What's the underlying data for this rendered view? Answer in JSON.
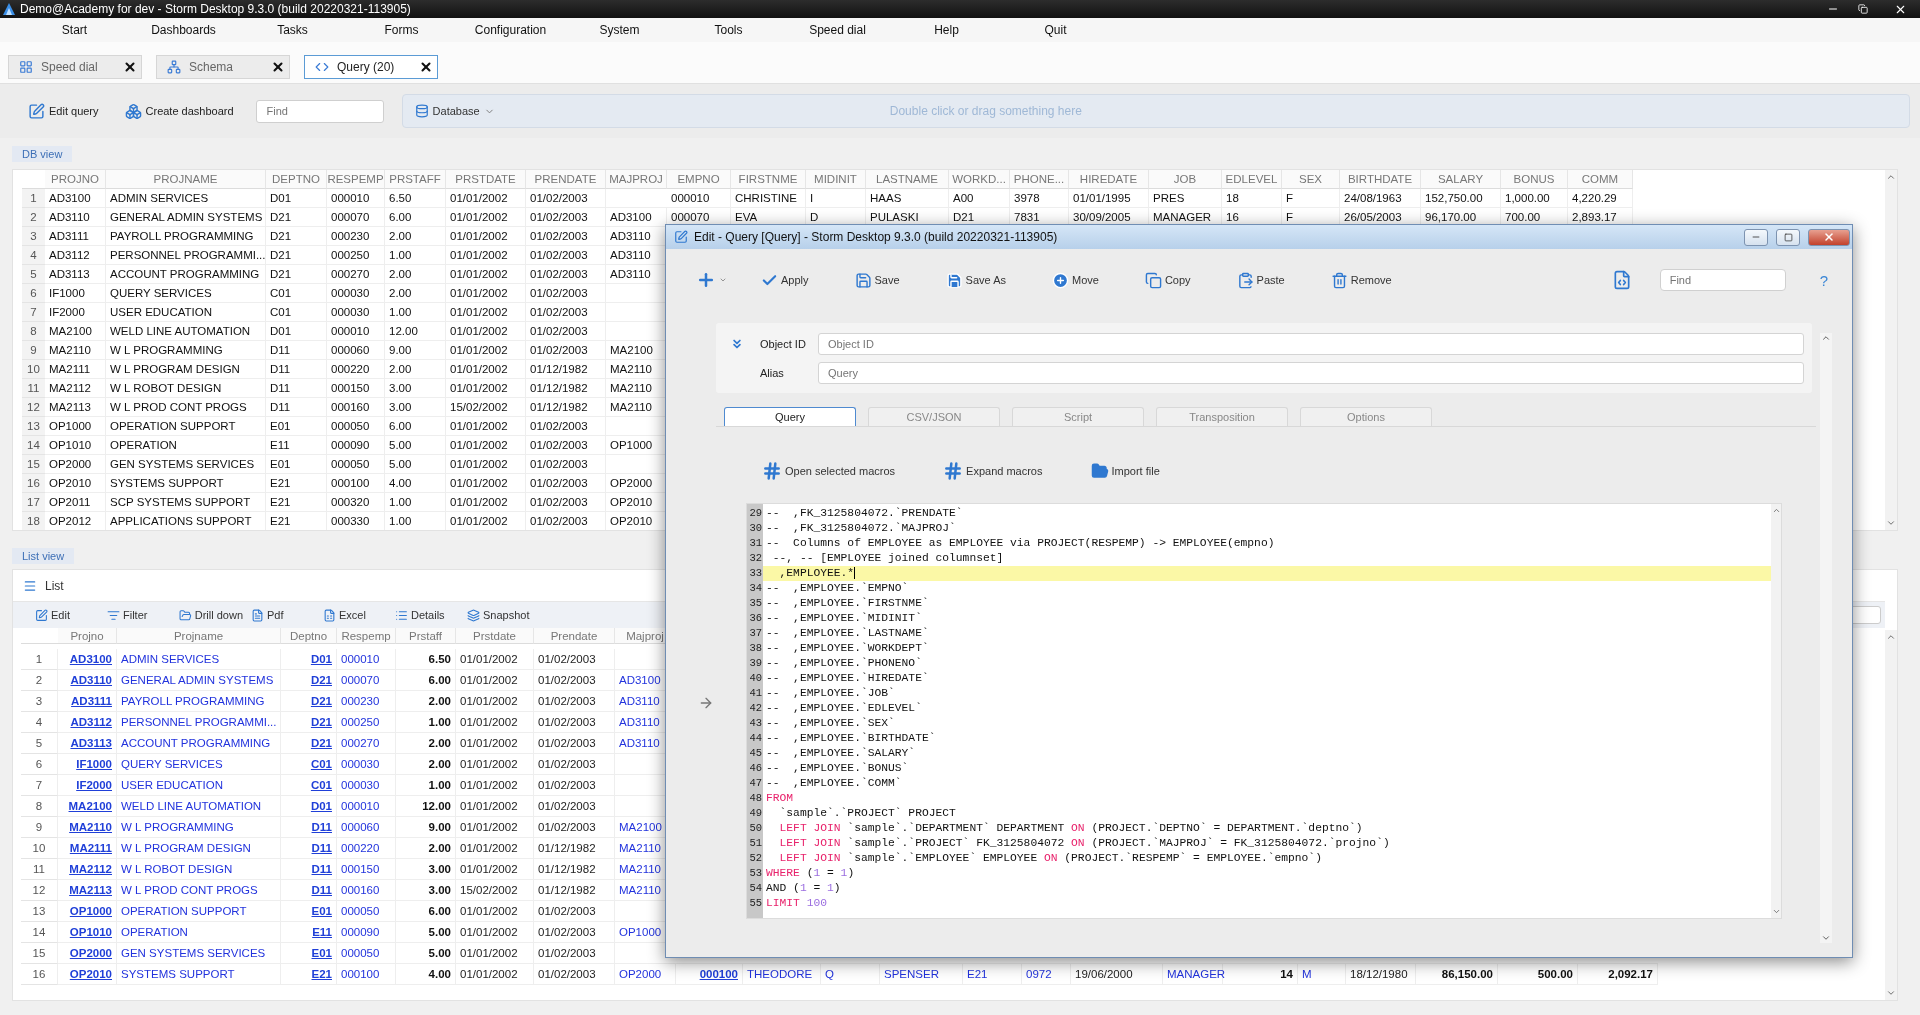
{
  "window": {
    "title": "Demo@Academy for dev -  Storm Desktop 9.3.0 (build 20220321-113905)"
  },
  "menu": [
    "Start",
    "Dashboards",
    "Tasks",
    "Forms",
    "Configuration",
    "System",
    "Tools",
    "Speed dial",
    "Help",
    "Quit"
  ],
  "tabs": [
    {
      "label": "Speed dial",
      "kind": "speed-dial",
      "selected": false
    },
    {
      "label": "Schema",
      "kind": "schema",
      "selected": false
    },
    {
      "label": "Query (20)",
      "kind": "query",
      "selected": true
    }
  ],
  "toolbar": {
    "buttons": [
      {
        "label": "Edit query",
        "kind": "edit"
      },
      {
        "label": "Create dashboard",
        "kind": "dashboard"
      }
    ],
    "search": {
      "placeholder": "Find"
    },
    "database": {
      "label": "Database"
    },
    "drop_zone": {
      "placeholder": "Double click or drag something here"
    }
  },
  "db_view": {
    "label": "DB view",
    "table": {
      "columns": [
        "PROJNO",
        "PROJNAME",
        "DEPTNO",
        "RESPEMP",
        "PRSTAFF",
        "PRSTDATE",
        "PRENDATE",
        "MAJPROJ",
        "EMPNO",
        "FIRSTNME",
        "MIDINIT",
        "LASTNAME",
        "WORKD...",
        "PHONE...",
        "HIREDATE",
        "JOB",
        "EDLEVEL",
        "SEX",
        "BIRTHDATE",
        "SALARY",
        "BONUS",
        "COMM"
      ],
      "rows": [
        {
          "number": "1",
          "cells": [
            "AD3100",
            "ADMIN SERVICES",
            "D01",
            "000010",
            "6.50",
            "01/01/2002",
            "01/02/2003",
            null,
            "000010",
            "CHRISTINE",
            "I",
            "HAAS",
            "A00",
            "3978",
            "01/01/1995",
            "PRES",
            "18",
            "F",
            "24/08/1963",
            "152,750.00",
            "1,000.00",
            "4,220.29"
          ]
        },
        {
          "number": "2",
          "cells": [
            "AD3110",
            "GENERAL ADMIN SYSTEMS",
            "D21",
            "000070",
            "6.00",
            "01/01/2002",
            "01/02/2003",
            "AD3100",
            "000070",
            "EVA",
            "D",
            "PULASKI",
            "D21",
            "7831",
            "30/09/2005",
            "MANAGER",
            "16",
            "F",
            "26/05/2003",
            "96,170.00",
            "700.00",
            "2,893.17"
          ]
        },
        {
          "number": "3",
          "cells": [
            "AD3111",
            "PAYROLL PROGRAMMING",
            "D21",
            "000230",
            "2.00",
            "01/01/2002",
            "01/02/2003",
            "AD3110"
          ]
        },
        {
          "number": "4",
          "cells": [
            "AD3112",
            "PERSONNEL PROGRAMMI...",
            "D21",
            "000250",
            "1.00",
            "01/01/2002",
            "01/02/2003",
            "AD3110"
          ]
        },
        {
          "number": "5",
          "cells": [
            "AD3113",
            "ACCOUNT PROGRAMMING",
            "D21",
            "000270",
            "2.00",
            "01/01/2002",
            "01/02/2003",
            "AD3110"
          ]
        },
        {
          "number": "6",
          "cells": [
            "IF1000",
            "QUERY SERVICES",
            "C01",
            "000030",
            "2.00",
            "01/01/2002",
            "01/02/2003"
          ]
        },
        {
          "number": "7",
          "cells": [
            "IF2000",
            "USER EDUCATION",
            "C01",
            "000030",
            "1.00",
            "01/01/2002",
            "01/02/2003"
          ]
        },
        {
          "number": "8",
          "cells": [
            "MA2100",
            "WELD LINE AUTOMATION",
            "D01",
            "000010",
            "12.00",
            "01/01/2002",
            "01/02/2003"
          ]
        },
        {
          "number": "9",
          "cells": [
            "MA2110",
            "W L PROGRAMMING",
            "D11",
            "000060",
            "9.00",
            "01/01/2002",
            "01/02/2003",
            "MA2100"
          ]
        },
        {
          "number": "10",
          "cells": [
            "MA2111",
            "W L PROGRAM DESIGN",
            "D11",
            "000220",
            "2.00",
            "01/01/2002",
            "01/12/1982",
            "MA2110"
          ]
        },
        {
          "number": "11",
          "cells": [
            "MA2112",
            "W L ROBOT DESIGN",
            "D11",
            "000150",
            "3.00",
            "01/01/2002",
            "01/12/1982",
            "MA2110"
          ]
        },
        {
          "number": "12",
          "cells": [
            "MA2113",
            "W L PROD CONT PROGS",
            "D11",
            "000160",
            "3.00",
            "15/02/2002",
            "01/12/1982",
            "MA2110"
          ]
        },
        {
          "number": "13",
          "cells": [
            "OP1000",
            "OPERATION SUPPORT",
            "E01",
            "000050",
            "6.00",
            "01/01/2002",
            "01/02/2003"
          ]
        },
        {
          "number": "14",
          "cells": [
            "OP1010",
            "OPERATION",
            "E11",
            "000090",
            "5.00",
            "01/01/2002",
            "01/02/2003",
            "OP1000"
          ]
        },
        {
          "number": "15",
          "cells": [
            "OP2000",
            "GEN SYSTEMS SERVICES",
            "E01",
            "000050",
            "5.00",
            "01/01/2002",
            "01/02/2003"
          ]
        },
        {
          "number": "16",
          "cells": [
            "OP2010",
            "SYSTEMS SUPPORT",
            "E21",
            "000100",
            "4.00",
            "01/01/2002",
            "01/02/2003",
            "OP2000"
          ]
        },
        {
          "number": "17",
          "cells": [
            "OP2011",
            "SCP SYSTEMS SUPPORT",
            "E21",
            "000320",
            "1.00",
            "01/01/2002",
            "01/02/2003",
            "OP2010"
          ]
        },
        {
          "number": "18",
          "cells": [
            "OP2012",
            "APPLICATIONS SUPPORT",
            "E21",
            "000330",
            "1.00",
            "01/01/2002",
            "01/02/2003",
            "OP2010"
          ]
        }
      ]
    }
  },
  "list_view": {
    "label": "List view",
    "title": "List",
    "toolbar": [
      {
        "label": "Edit",
        "kind": "edit"
      },
      {
        "label": "Filter",
        "kind": "filter"
      },
      {
        "label": "Drill down",
        "kind": "drill"
      },
      {
        "label": "Pdf",
        "kind": "pdf"
      },
      {
        "label": "Excel",
        "kind": "excel"
      },
      {
        "label": "Details",
        "kind": "details"
      },
      {
        "label": "Snapshot",
        "kind": "snapshot"
      }
    ],
    "table": {
      "columns": [
        {
          "label": "Projno",
          "kind": "link"
        },
        {
          "label": "Projname",
          "kind": "text"
        },
        {
          "label": "Deptno",
          "kind": "link"
        },
        {
          "label": "Respemp",
          "kind": "text"
        },
        {
          "label": "Prstaff",
          "kind": "number"
        },
        {
          "label": "Prstdate",
          "kind": "date"
        },
        {
          "label": "Prendate",
          "kind": "date"
        },
        {
          "label": "Majproj",
          "kind": "text"
        },
        {
          "kind": "link"
        },
        {
          "kind": "text"
        },
        {
          "kind": "text"
        },
        {
          "kind": "text"
        },
        {
          "kind": "text"
        },
        {
          "kind": "text"
        },
        {
          "kind": "date"
        },
        {
          "kind": "text"
        },
        {
          "kind": "number"
        },
        {
          "kind": "text"
        },
        {
          "kind": "date"
        },
        {
          "kind": "number"
        },
        {
          "kind": "number"
        },
        {
          "kind": "number"
        }
      ],
      "rows": [
        {
          "number": "1",
          "cells": [
            "AD3100",
            "ADMIN SERVICES",
            "D01",
            "000010",
            "6.50",
            "01/01/2002",
            "01/02/2003"
          ]
        },
        {
          "number": "2",
          "cells": [
            "AD3110",
            "GENERAL ADMIN SYSTEMS",
            "D21",
            "000070",
            "6.00",
            "01/01/2002",
            "01/02/2003",
            "AD3100"
          ]
        },
        {
          "number": "3",
          "cells": [
            "AD3111",
            "PAYROLL PROGRAMMING",
            "D21",
            "000230",
            "2.00",
            "01/01/2002",
            "01/02/2003",
            "AD3110"
          ]
        },
        {
          "number": "4",
          "cells": [
            "AD3112",
            "PERSONNEL PROGRAMMI...",
            "D21",
            "000250",
            "1.00",
            "01/01/2002",
            "01/02/2003",
            "AD3110"
          ]
        },
        {
          "number": "5",
          "cells": [
            "AD3113",
            "ACCOUNT PROGRAMMING",
            "D21",
            "000270",
            "2.00",
            "01/01/2002",
            "01/02/2003",
            "AD3110"
          ]
        },
        {
          "number": "6",
          "cells": [
            "IF1000",
            "QUERY SERVICES",
            "C01",
            "000030",
            "2.00",
            "01/01/2002",
            "01/02/2003"
          ]
        },
        {
          "number": "7",
          "cells": [
            "IF2000",
            "USER EDUCATION",
            "C01",
            "000030",
            "1.00",
            "01/01/2002",
            "01/02/2003"
          ]
        },
        {
          "number": "8",
          "cells": [
            "MA2100",
            "WELD LINE AUTOMATION",
            "D01",
            "000010",
            "12.00",
            "01/01/2002",
            "01/02/2003"
          ]
        },
        {
          "number": "9",
          "cells": [
            "MA2110",
            "W L PROGRAMMING",
            "D11",
            "000060",
            "9.00",
            "01/01/2002",
            "01/02/2003",
            "MA2100"
          ]
        },
        {
          "number": "10",
          "cells": [
            "MA2111",
            "W L PROGRAM DESIGN",
            "D11",
            "000220",
            "2.00",
            "01/01/2002",
            "01/12/1982",
            "MA2110"
          ]
        },
        {
          "number": "11",
          "cells": [
            "MA2112",
            "W L ROBOT DESIGN",
            "D11",
            "000150",
            "3.00",
            "01/01/2002",
            "01/12/1982",
            "MA2110"
          ]
        },
        {
          "number": "12",
          "cells": [
            "MA2113",
            "W L PROD CONT PROGS",
            "D11",
            "000160",
            "3.00",
            "15/02/2002",
            "01/12/1982",
            "MA2110"
          ]
        },
        {
          "number": "13",
          "cells": [
            "OP1000",
            "OPERATION SUPPORT",
            "E01",
            "000050",
            "6.00",
            "01/01/2002",
            "01/02/2003"
          ]
        },
        {
          "number": "14",
          "cells": [
            "OP1010",
            "OPERATION",
            "E11",
            "000090",
            "5.00",
            "01/01/2002",
            "01/02/2003",
            "OP1000"
          ]
        },
        {
          "number": "15",
          "cells": [
            "OP2000",
            "GEN SYSTEMS SERVICES",
            "E01",
            "000050",
            "5.00",
            "01/01/2002",
            "01/02/2003"
          ]
        },
        {
          "number": "16",
          "cells": [
            "OP2010",
            "SYSTEMS SUPPORT",
            "E21",
            "000100",
            "4.00",
            "01/01/2002",
            "01/02/2003",
            "OP2000",
            "000100",
            "THEODORE",
            "Q",
            "SPENSER",
            "E21",
            "0972",
            "19/06/2000",
            "MANAGER",
            "14",
            "M",
            "18/12/1980",
            "86,150.00",
            "500.00",
            "2,092.17"
          ]
        }
      ]
    }
  },
  "dialog": {
    "title": "Edit - Query [Query] -  Storm Desktop 9.3.0 (build 20220321-113905)",
    "toolbar": [
      {
        "label": "Apply",
        "kind": "apply"
      },
      {
        "label": "Save",
        "kind": "save"
      },
      {
        "label": "Save As",
        "kind": "save-as"
      },
      {
        "label": "Move",
        "kind": "move"
      },
      {
        "label": "Copy",
        "kind": "copy"
      },
      {
        "label": "Paste",
        "kind": "paste"
      },
      {
        "label": "Remove",
        "kind": "remove"
      }
    ],
    "search": {
      "placeholder": "Find"
    },
    "help": "?",
    "fields": [
      {
        "label": "Object ID",
        "placeholder": "Object ID"
      },
      {
        "label": "Alias",
        "placeholder": "Query"
      }
    ],
    "tabs": [
      {
        "label": "Query",
        "selected": true
      },
      {
        "label": "CSV/JSON",
        "selected": false
      },
      {
        "label": "Script",
        "selected": false
      },
      {
        "label": "Transposition",
        "selected": false
      },
      {
        "label": "Options",
        "selected": false
      }
    ],
    "actions": [
      {
        "label": "Open selected macros",
        "kind": "macro"
      },
      {
        "label": "Expand macros",
        "kind": "macro"
      },
      {
        "label": "Import file",
        "kind": "folder"
      }
    ],
    "editor": {
      "lines": [
        {
          "number": "29",
          "current": false,
          "tokens": [
            {
              "kind": "plain",
              "text": "--  ,FK_3125804072.`PRENDATE`"
            }
          ]
        },
        {
          "number": "30",
          "current": false,
          "tokens": [
            {
              "kind": "plain",
              "text": "--  ,FK_3125804072.`MAJPROJ`"
            }
          ]
        },
        {
          "number": "31",
          "current": false,
          "tokens": [
            {
              "kind": "plain",
              "text": "--  Columns of EMPLOYEE as EMPLOYEE via PROJECT(RESPEMP) -> EMPLOYEE(empno)"
            }
          ]
        },
        {
          "number": "32",
          "current": false,
          "tokens": [
            {
              "kind": "plain",
              "text": " --, -- [EMPLOYEE joined columnset]"
            }
          ]
        },
        {
          "number": "33",
          "current": true,
          "tokens": [
            {
              "kind": "plain",
              "text": "  ,EMPLOYEE.*"
            }
          ]
        },
        {
          "number": "34",
          "current": false,
          "tokens": [
            {
              "kind": "plain",
              "text": "--  ,EMPLOYEE.`EMPNO`"
            }
          ]
        },
        {
          "number": "35",
          "current": false,
          "tokens": [
            {
              "kind": "plain",
              "text": "--  ,EMPLOYEE.`FIRSTNME`"
            }
          ]
        },
        {
          "number": "36",
          "current": false,
          "tokens": [
            {
              "kind": "plain",
              "text": "--  ,EMPLOYEE.`MIDINIT`"
            }
          ]
        },
        {
          "number": "37",
          "current": false,
          "tokens": [
            {
              "kind": "plain",
              "text": "--  ,EMPLOYEE.`LASTNAME`"
            }
          ]
        },
        {
          "number": "38",
          "current": false,
          "tokens": [
            {
              "kind": "plain",
              "text": "--  ,EMPLOYEE.`WORKDEPT`"
            }
          ]
        },
        {
          "number": "39",
          "current": false,
          "tokens": [
            {
              "kind": "plain",
              "text": "--  ,EMPLOYEE.`PHONENO`"
            }
          ]
        },
        {
          "number": "40",
          "current": false,
          "tokens": [
            {
              "kind": "plain",
              "text": "--  ,EMPLOYEE.`HIREDATE`"
            }
          ]
        },
        {
          "number": "41",
          "current": false,
          "tokens": [
            {
              "kind": "plain",
              "text": "--  ,EMPLOYEE.`JOB`"
            }
          ]
        },
        {
          "number": "42",
          "current": false,
          "tokens": [
            {
              "kind": "plain",
              "text": "--  ,EMPLOYEE.`EDLEVEL`"
            }
          ]
        },
        {
          "number": "43",
          "current": false,
          "tokens": [
            {
              "kind": "plain",
              "text": "--  ,EMPLOYEE.`SEX`"
            }
          ]
        },
        {
          "number": "44",
          "current": false,
          "tokens": [
            {
              "kind": "plain",
              "text": "--  ,EMPLOYEE.`BIRTHDATE`"
            }
          ]
        },
        {
          "number": "45",
          "current": false,
          "tokens": [
            {
              "kind": "plain",
              "text": "--  ,EMPLOYEE.`SALARY`"
            }
          ]
        },
        {
          "number": "46",
          "current": false,
          "tokens": [
            {
              "kind": "plain",
              "text": "--  ,EMPLOYEE.`BONUS`"
            }
          ]
        },
        {
          "number": "47",
          "current": false,
          "tokens": [
            {
              "kind": "plain",
              "text": "--  ,EMPLOYEE.`COMM`"
            }
          ]
        },
        {
          "number": "48",
          "current": false,
          "tokens": [
            {
              "kind": "keyword",
              "text": "FROM"
            }
          ]
        },
        {
          "number": "49",
          "current": false,
          "tokens": [
            {
              "kind": "plain",
              "text": "  `sample`.`PROJECT` PROJECT"
            }
          ]
        },
        {
          "number": "50",
          "current": false,
          "tokens": [
            {
              "kind": "keyword",
              "text": "  LEFT JOIN"
            },
            {
              "kind": "plain",
              "text": " `sample`.`DEPARTMENT` DEPARTMENT "
            },
            {
              "kind": "keyword",
              "text": "ON"
            },
            {
              "kind": "plain",
              "text": " (PROJECT.`DEPTNO` = DEPARTMENT.`deptno`)"
            }
          ]
        },
        {
          "number": "51",
          "current": false,
          "tokens": [
            {
              "kind": "keyword",
              "text": "  LEFT JOIN"
            },
            {
              "kind": "plain",
              "text": " `sample`.`PROJECT` FK_3125804072 "
            },
            {
              "kind": "keyword",
              "text": "ON"
            },
            {
              "kind": "plain",
              "text": " (PROJECT.`MAJPROJ` = FK_3125804072.`projno`)"
            }
          ]
        },
        {
          "number": "52",
          "current": false,
          "tokens": [
            {
              "kind": "keyword",
              "text": "  LEFT JOIN"
            },
            {
              "kind": "plain",
              "text": " `sample`.`EMPLOYEE` EMPLOYEE "
            },
            {
              "kind": "keyword",
              "text": "ON"
            },
            {
              "kind": "plain",
              "text": " (PROJECT.`RESPEMP` = EMPLOYEE.`empno`)"
            }
          ]
        },
        {
          "number": "53",
          "current": false,
          "tokens": [
            {
              "kind": "keyword",
              "text": "WHERE"
            },
            {
              "kind": "plain",
              "text": " ("
            },
            {
              "kind": "number",
              "text": "1"
            },
            {
              "kind": "plain",
              "text": " = "
            },
            {
              "kind": "number",
              "text": "1"
            },
            {
              "kind": "plain",
              "text": ")"
            }
          ]
        },
        {
          "number": "54",
          "current": false,
          "tokens": [
            {
              "kind": "plain",
              "text": "AND ("
            },
            {
              "kind": "number",
              "text": "1"
            },
            {
              "kind": "plain",
              "text": " = "
            },
            {
              "kind": "number",
              "text": "1"
            },
            {
              "kind": "plain",
              "text": ")"
            }
          ]
        },
        {
          "number": "55",
          "current": false,
          "tokens": [
            {
              "kind": "keyword",
              "text": "LIMIT"
            },
            {
              "kind": "number",
              "text": " 100"
            }
          ]
        }
      ]
    }
  }
}
